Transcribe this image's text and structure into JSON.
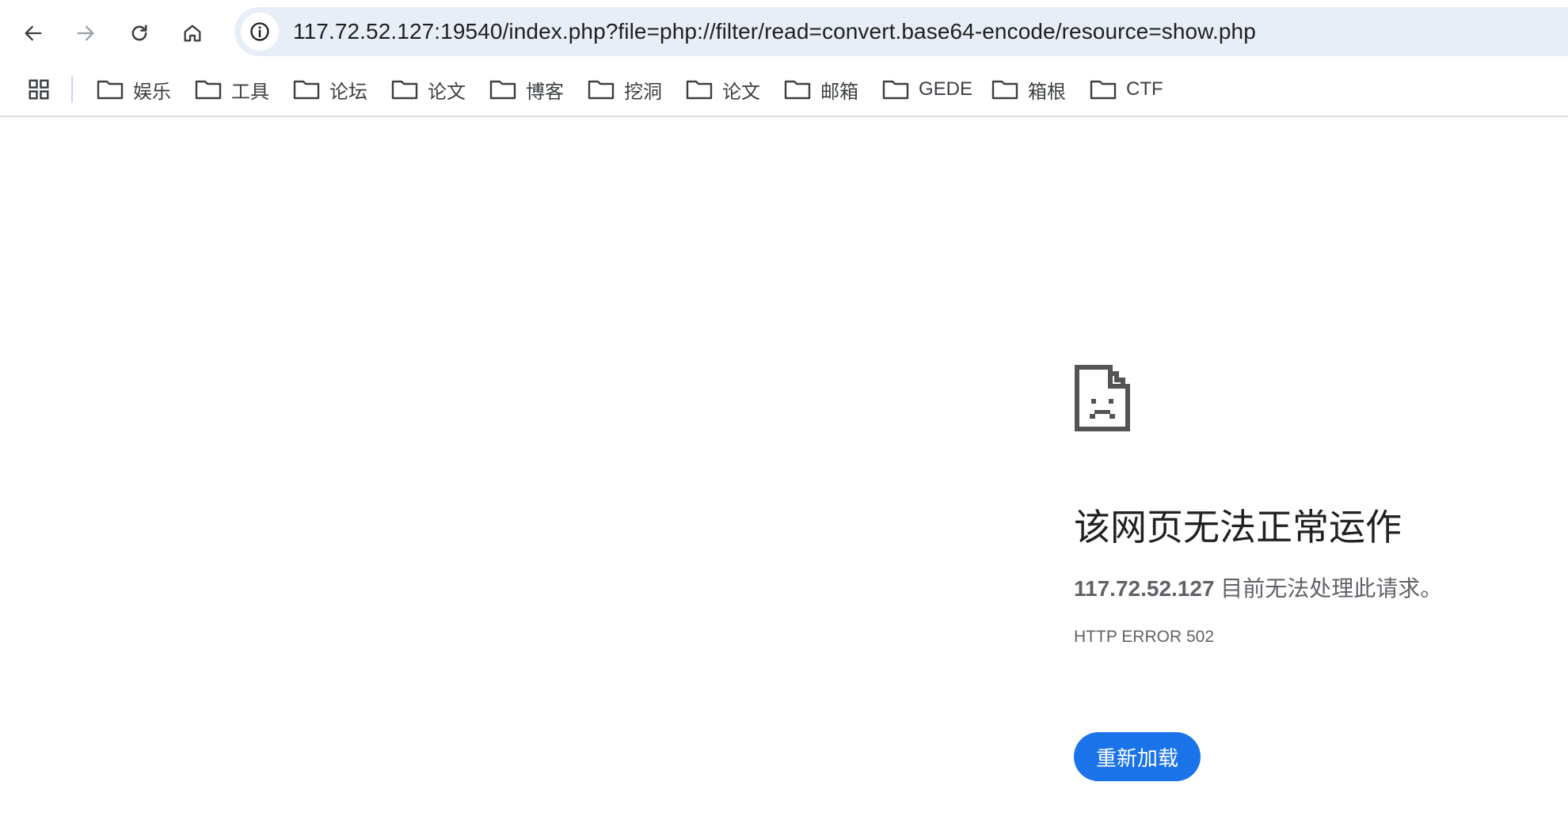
{
  "browser": {
    "url": "117.72.52.127:19540/index.php?file=php://filter/read=convert.base64-encode/resource=show.php",
    "nav_icons": [
      "back-arrow-icon",
      "forward-arrow-icon",
      "reload-icon",
      "home-icon"
    ],
    "site_info_icon": "info-circle-icon"
  },
  "bookmarks": {
    "apps_icon": "apps-grid-icon",
    "items": [
      {
        "label": "娱乐"
      },
      {
        "label": "工具"
      },
      {
        "label": "论坛"
      },
      {
        "label": "论文"
      },
      {
        "label": "博客"
      },
      {
        "label": "挖洞"
      },
      {
        "label": "论文"
      },
      {
        "label": "邮箱"
      },
      {
        "label": "GEDE"
      },
      {
        "label": "箱根"
      },
      {
        "label": "CTF"
      }
    ]
  },
  "error_page": {
    "icon": "sad-page-icon",
    "title": "该网页无法正常运作",
    "host": "117.72.52.127",
    "message": " 目前无法处理此请求。",
    "code": "HTTP ERROR 502",
    "reload_label": "重新加载",
    "accent_color": "#1a73e8"
  }
}
